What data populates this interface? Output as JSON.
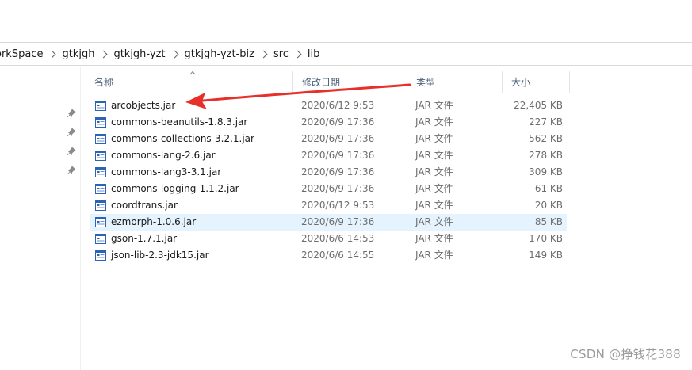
{
  "breadcrumb": [
    "orkSpace",
    "gtkjgh",
    "gtkjgh-yzt",
    "gtkjgh-yzt-biz",
    "src",
    "lib"
  ],
  "columns": {
    "name": "名称",
    "modified": "修改日期",
    "type": "类型",
    "size": "大小"
  },
  "files": [
    {
      "name": "arcobjects.jar",
      "modified": "2020/6/12 9:53",
      "type": "JAR 文件",
      "size": "22,405 KB",
      "selected": false
    },
    {
      "name": "commons-beanutils-1.8.3.jar",
      "modified": "2020/6/9 17:36",
      "type": "JAR 文件",
      "size": "227 KB",
      "selected": false
    },
    {
      "name": "commons-collections-3.2.1.jar",
      "modified": "2020/6/9 17:36",
      "type": "JAR 文件",
      "size": "562 KB",
      "selected": false
    },
    {
      "name": "commons-lang-2.6.jar",
      "modified": "2020/6/9 17:36",
      "type": "JAR 文件",
      "size": "278 KB",
      "selected": false
    },
    {
      "name": "commons-lang3-3.1.jar",
      "modified": "2020/6/9 17:36",
      "type": "JAR 文件",
      "size": "309 KB",
      "selected": false
    },
    {
      "name": "commons-logging-1.1.2.jar",
      "modified": "2020/6/9 17:36",
      "type": "JAR 文件",
      "size": "61 KB",
      "selected": false
    },
    {
      "name": "coordtrans.jar",
      "modified": "2020/6/12 9:53",
      "type": "JAR 文件",
      "size": "20 KB",
      "selected": false
    },
    {
      "name": "ezmorph-1.0.6.jar",
      "modified": "2020/6/9 17:36",
      "type": "JAR 文件",
      "size": "85 KB",
      "selected": true
    },
    {
      "name": "gson-1.7.1.jar",
      "modified": "2020/6/6 14:53",
      "type": "JAR 文件",
      "size": "170 KB",
      "selected": false
    },
    {
      "name": "json-lib-2.3-jdk15.jar",
      "modified": "2020/6/6 14:55",
      "type": "JAR 文件",
      "size": "149 KB",
      "selected": false
    }
  ],
  "watermark": "CSDN @挣钱花388",
  "colors": {
    "arrow": "#e8302a",
    "selection": "#e5f3ff",
    "header_text": "#4c607a",
    "icon_blue": "#2a63b8"
  },
  "icons": {
    "pin": "pin-icon",
    "file": "jar-file-icon",
    "separator": "chevron-right-icon",
    "sort": "sort-ascending-icon"
  }
}
